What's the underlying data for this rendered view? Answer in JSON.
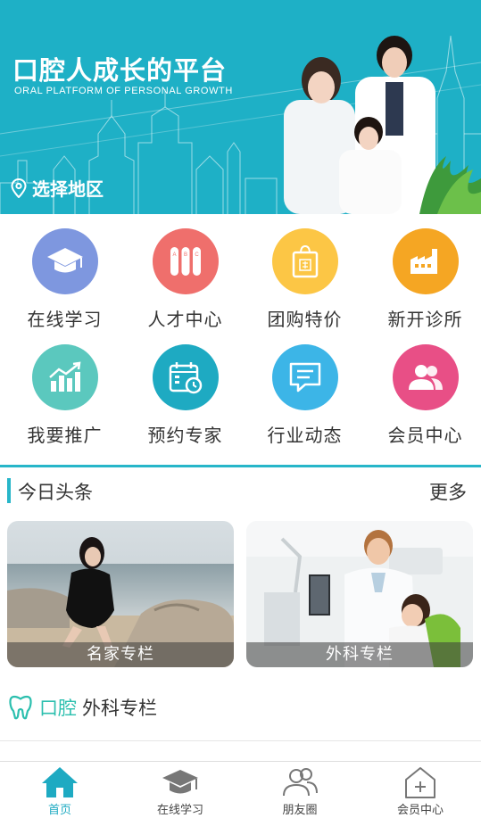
{
  "banner": {
    "title": "口腔人成长的平台",
    "subtitle": "ORAL PLATFORM OF PERSONAL GROWTH",
    "region_label": "选择地区"
  },
  "grid": [
    {
      "label": "在线学习",
      "icon": "graduation-cap-icon",
      "color": "#7e97df"
    },
    {
      "label": "人才中心",
      "icon": "abc-bars-icon",
      "color": "#ef6f6c"
    },
    {
      "label": "团购特价",
      "icon": "shopping-bag-icon",
      "color": "#fcc645"
    },
    {
      "label": "新开诊所",
      "icon": "factory-icon",
      "color": "#f5a623"
    },
    {
      "label": "我要推广",
      "icon": "growth-chart-icon",
      "color": "#5bc8be"
    },
    {
      "label": "预约专家",
      "icon": "calendar-clock-icon",
      "color": "#1eaac2"
    },
    {
      "label": "行业动态",
      "icon": "message-icon",
      "color": "#3cb5e7"
    },
    {
      "label": "会员中心",
      "icon": "members-icon",
      "color": "#e84f86"
    }
  ],
  "headlines": {
    "title": "今日头条",
    "more": "更多",
    "cards": [
      {
        "caption": "名家专栏"
      },
      {
        "caption": "外科专栏"
      }
    ]
  },
  "dental_section": {
    "part1": "口腔",
    "part2": "外科专栏"
  },
  "tabbar": [
    {
      "label": "首页",
      "icon": "home-icon",
      "active": true
    },
    {
      "label": "在线学习",
      "icon": "graduation-cap-icon",
      "active": false
    },
    {
      "label": "朋友圈",
      "icon": "friends-icon",
      "active": false
    },
    {
      "label": "会员中心",
      "icon": "member-center-icon",
      "active": false
    }
  ],
  "colors": {
    "accent": "#1eb0c6",
    "active_tab": "#1eaac2",
    "dental_green": "#2bbfae"
  }
}
